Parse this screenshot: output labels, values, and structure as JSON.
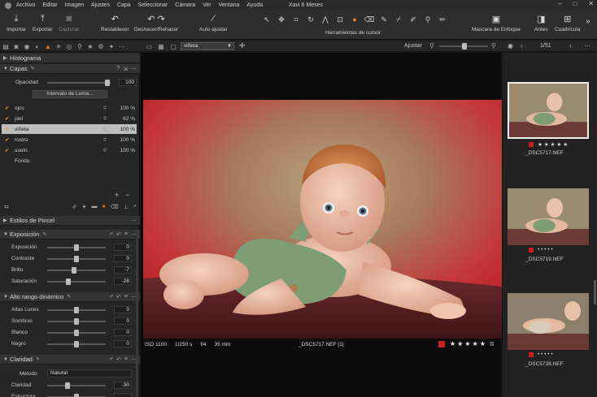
{
  "menu": {
    "items": [
      "Archivo",
      "Editar",
      "Imagen",
      "Ajustes",
      "Capa",
      "Seleccionar",
      "Cámara",
      "Ver",
      "Ventana",
      "Ayuda"
    ],
    "doc_title": "Xavi 6 Meses",
    "window_buttons": [
      "–",
      "□",
      "✕"
    ]
  },
  "toolbar": {
    "importar": "Importar",
    "exportar": "Exportar",
    "capturar": "Capturar",
    "restablecer": "Restablecer",
    "deshacer": "Deshacer/Rehacer",
    "auto_ajustar": "Auto ajustar",
    "herramientas": "Herramientas de cursor",
    "mascara": "Máscara de Enfoque",
    "antes": "Antes",
    "cuadricula": "Cuadrícula"
  },
  "subbar": {
    "layer_selected": "viñeta",
    "ajustar": "Ajustar",
    "counter": "1/51"
  },
  "left": {
    "histograma": "Histograma",
    "capas": "Capas",
    "opacidad_label": "Opacidad",
    "opacidad_value": "100",
    "opacidad_level": 0.95,
    "luma_button": "Intervalo de Luma...",
    "layers": [
      {
        "name": "ojos",
        "pct": "100 %",
        "checked": true
      },
      {
        "name": "piel",
        "pct": "62 %",
        "checked": true
      },
      {
        "name": "viñeta",
        "pct": "100 %",
        "checked": true,
        "selected": true
      },
      {
        "name": "rostro",
        "pct": "100 %",
        "checked": true
      },
      {
        "name": "suelo",
        "pct": "100 %",
        "checked": true
      },
      {
        "name": "Fondo",
        "pct": "",
        "checked": false
      }
    ],
    "estilos": "Estilos de Pincel",
    "exposicion": {
      "title": "Exposición",
      "rows": [
        {
          "label": "Exposición",
          "value": "0"
        },
        {
          "label": "Contraste",
          "value": "0"
        },
        {
          "label": "Brillo",
          "value": "-7"
        },
        {
          "label": "Saturación",
          "value": "-28"
        }
      ]
    },
    "hdr": {
      "title": "Alto rango dinámico",
      "rows": [
        {
          "label": "Altas Luces",
          "value": "0"
        },
        {
          "label": "Sombras",
          "value": "0"
        },
        {
          "label": "Blanco",
          "value": "0"
        },
        {
          "label": "Negro",
          "value": "0"
        }
      ]
    },
    "claridad": {
      "title": "Claridad",
      "metodo_label": "Método",
      "metodo_value": "Natural",
      "rows": [
        {
          "label": "Claridad",
          "value": "-30"
        },
        {
          "label": "Estructura",
          "value": ""
        }
      ]
    }
  },
  "viewer": {
    "iso": "ISO 1100",
    "shutter": "1/250 s",
    "aperture": "f/4",
    "focal": "35 mm",
    "filename": "_DSC5717.NEF [1]"
  },
  "filmstrip": [
    {
      "name": "_DSC5717.NEF",
      "selected": true
    },
    {
      "name": "_DSC5719.NEF",
      "selected": false
    },
    {
      "name": "_DSC5728.NEF",
      "selected": false
    }
  ],
  "colors": {
    "accent": "#f07b1e",
    "red_label": "#c81f1f",
    "panel": "#262626",
    "selection": "#bdbdbd"
  }
}
